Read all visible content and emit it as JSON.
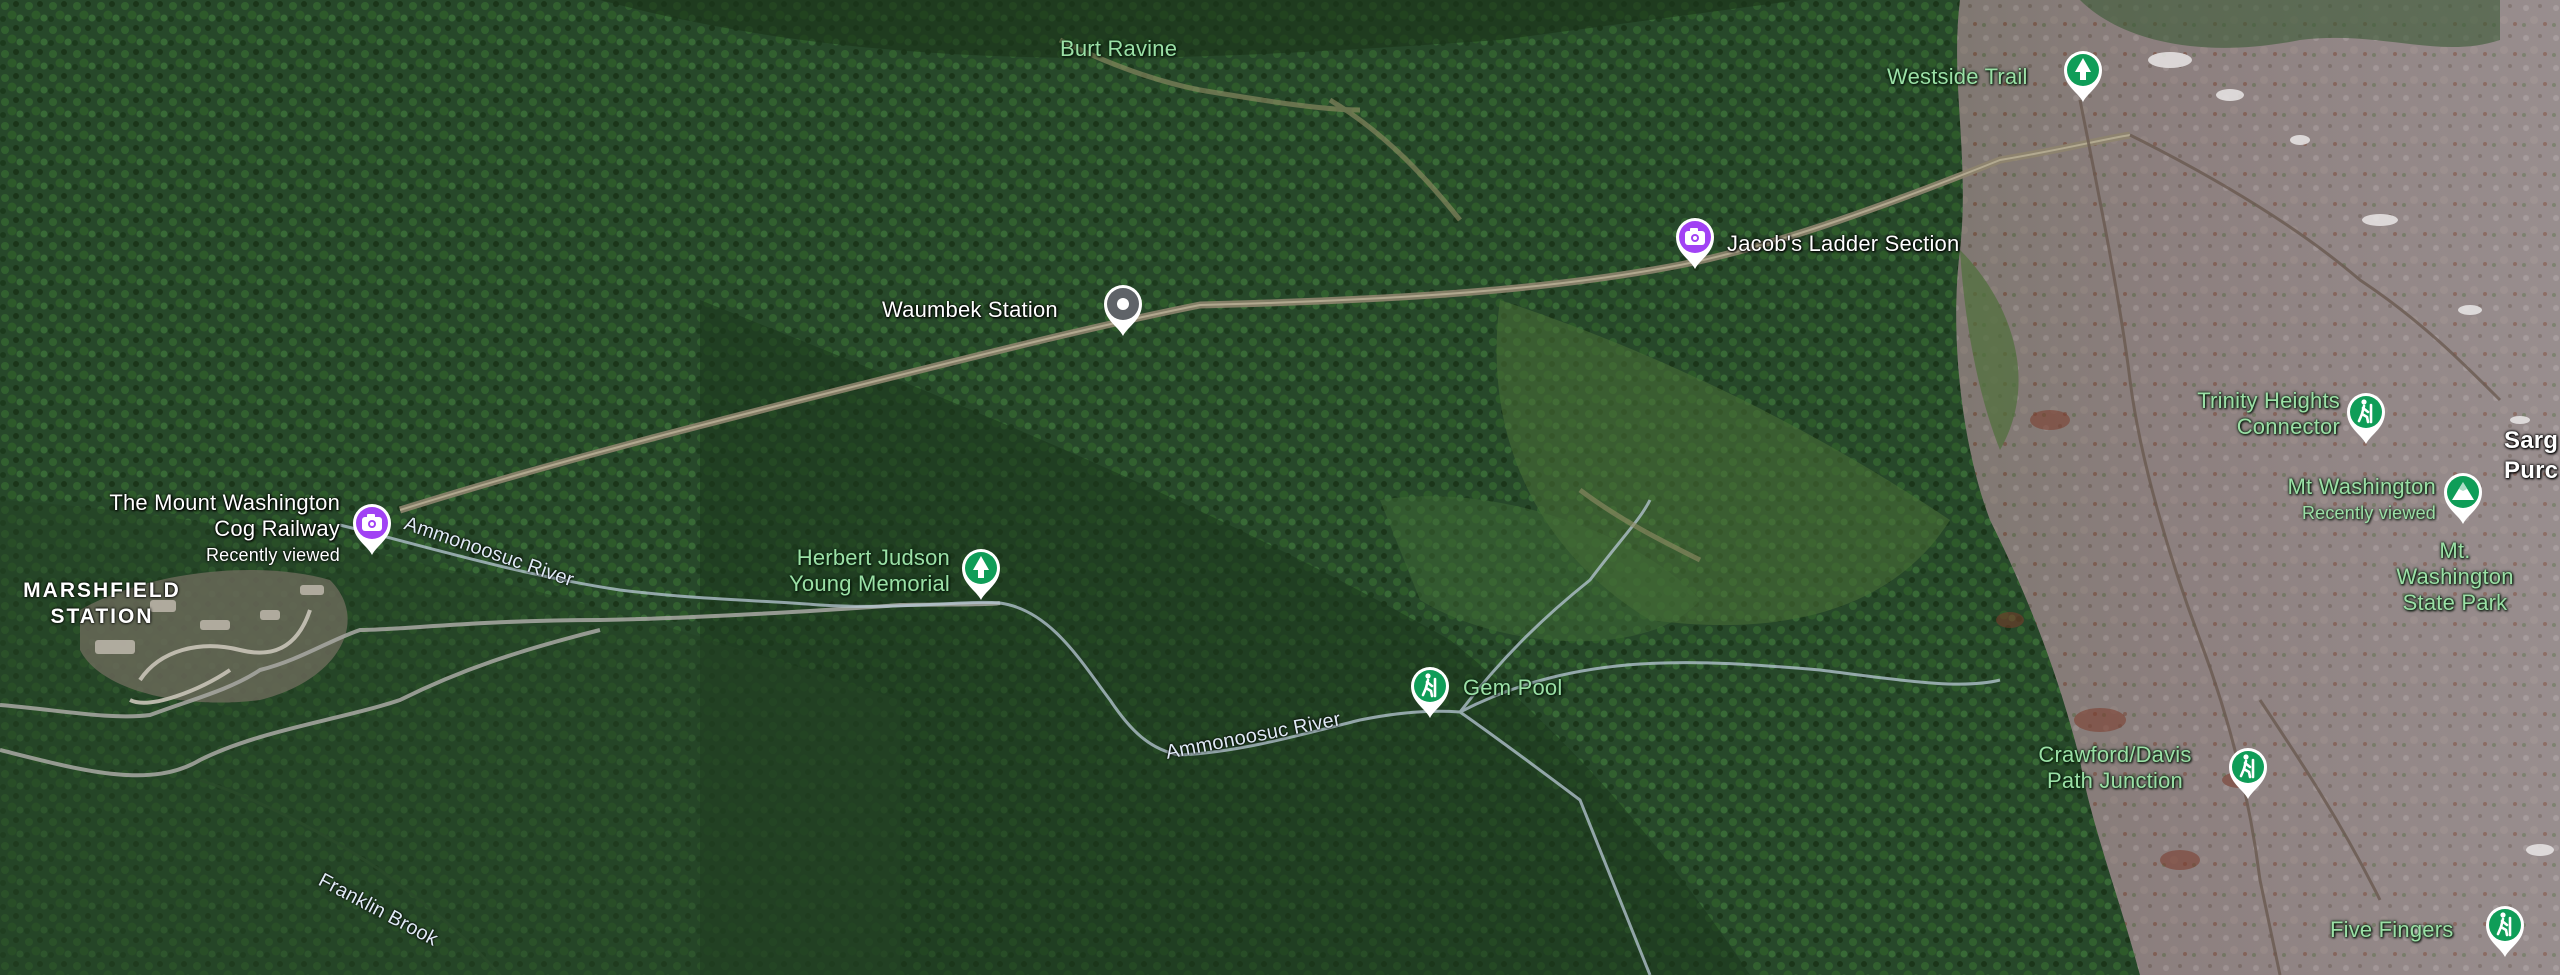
{
  "map": {
    "type": "satellite",
    "colors": {
      "forest_dark": "#1d3a20",
      "forest_mid": "#2f5a2b",
      "alpine_rock": "#8e7e7e",
      "park_green": "#0f9d58",
      "viewpoint_purple": "#a142f4",
      "station_gray": "#5f6368",
      "label_green": "#9be0a6",
      "river_blue": "#dfe9f5"
    }
  },
  "labels": {
    "burt_ravine": "Burt Ravine",
    "westside_trail": "Westside Trail",
    "jacobs_ladder": "Jacob's Ladder Section",
    "waumbek_station": "Waumbek Station",
    "cog_railway_line1": "The Mount Washington",
    "cog_railway_line2": "Cog Railway",
    "cog_railway_sub": "Recently viewed",
    "marshfield_line1": "MARSHFIELD",
    "marshfield_line2": "STATION",
    "river_1": "Ammonoosuc River",
    "river_2": "Ammonoosuc River",
    "herbert_line1": "Herbert Judson",
    "herbert_line2": "Young Memorial",
    "gem_pool": "Gem Pool",
    "trinity_line1": "Trinity Heights",
    "trinity_line2": "Connector",
    "sarg_line1": "Sarg",
    "sarg_line2": "Purc",
    "mt_washington": "Mt Washington",
    "mt_washington_sub": "Recently viewed",
    "state_park_line1": "Mt.",
    "state_park_line2": "Washington",
    "state_park_line3": "State Park",
    "crawford_line1": "Crawford/Davis",
    "crawford_line2": "Path Junction",
    "five_fingers": "Five Fingers",
    "franklin_brook": "Franklin Brook"
  },
  "pins": [
    {
      "name": "westside-trail-pin",
      "icon": "park-tree-icon",
      "color": "#0f9d58"
    },
    {
      "name": "jacobs-ladder-pin",
      "icon": "camera-icon",
      "color": "#a142f4"
    },
    {
      "name": "waumbek-station-pin",
      "icon": "dot-icon",
      "color": "#5f6368"
    },
    {
      "name": "cog-railway-pin",
      "icon": "camera-icon",
      "color": "#a142f4"
    },
    {
      "name": "herbert-memorial-pin",
      "icon": "park-tree-icon",
      "color": "#0f9d58"
    },
    {
      "name": "gem-pool-pin",
      "icon": "hiker-icon",
      "color": "#0f9d58"
    },
    {
      "name": "trinity-connector-pin",
      "icon": "hiker-icon",
      "color": "#0f9d58"
    },
    {
      "name": "mt-washington-pin",
      "icon": "mountain-icon",
      "color": "#0f9d58"
    },
    {
      "name": "crawford-junction-pin",
      "icon": "hiker-icon",
      "color": "#0f9d58"
    },
    {
      "name": "five-fingers-pin",
      "icon": "hiker-icon",
      "color": "#0f9d58"
    }
  ]
}
